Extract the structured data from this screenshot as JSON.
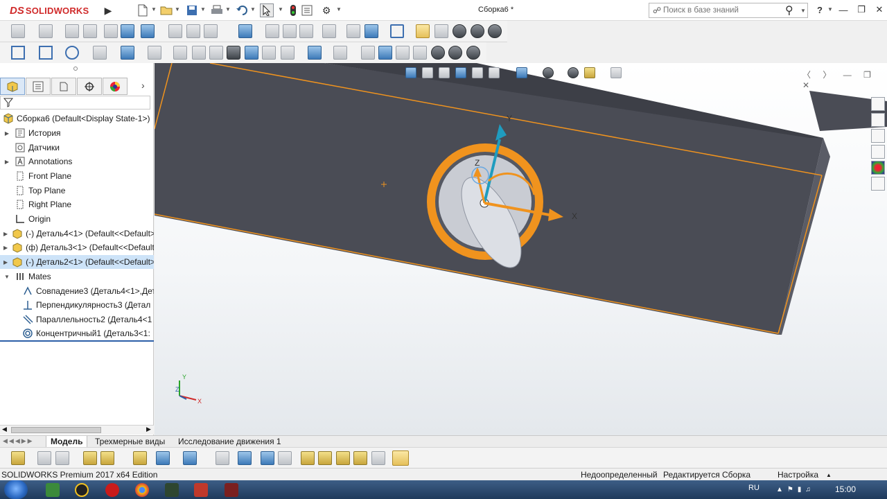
{
  "app": {
    "logo_ds": "DS",
    "logo_text": "SOLIDWORKS",
    "document_title": "Сборка6 *",
    "search_placeholder": "Поиск в базе знаний",
    "help_label": "?"
  },
  "feature_manager": {
    "root": "Сборка6  (Default<Display State-1>)",
    "items": [
      {
        "label": "История",
        "icon": "history-icon",
        "expandable": true
      },
      {
        "label": "Датчики",
        "icon": "sensor-icon",
        "expandable": false
      },
      {
        "label": "Annotations",
        "icon": "annotations-icon",
        "expandable": true
      },
      {
        "label": "Front Plane",
        "icon": "plane-icon",
        "expandable": false
      },
      {
        "label": "Top Plane",
        "icon": "plane-icon",
        "expandable": false
      },
      {
        "label": "Right Plane",
        "icon": "plane-icon",
        "expandable": false
      },
      {
        "label": "Origin",
        "icon": "origin-icon",
        "expandable": false
      },
      {
        "label": "(-) Деталь4<1> (Default<<Default>",
        "icon": "part-icon",
        "expandable": true
      },
      {
        "label": "(ф) Деталь3<1> (Default<<Default>",
        "icon": "part-icon",
        "expandable": true
      },
      {
        "label": "(-) Деталь2<1> (Default<<Default>",
        "icon": "part-icon",
        "expandable": true,
        "selected": true
      },
      {
        "label": "Mates",
        "icon": "mates-icon",
        "expandable": true,
        "expanded": true
      }
    ],
    "mates": [
      {
        "label": "Совпадение3 (Деталь4<1>,Дет",
        "icon": "coincident-icon"
      },
      {
        "label": "Перпендикулярность3 (Детал",
        "icon": "perpendicular-icon"
      },
      {
        "label": "Параллельность2 (Деталь4<1",
        "icon": "parallel-icon"
      },
      {
        "label": "Концентричный1 (Деталь3<1:",
        "icon": "concentric-icon"
      }
    ]
  },
  "viewport": {
    "axis_x": "X",
    "axis_y": "Y",
    "axis_z": "Z",
    "triad_x": "X",
    "triad_y": "Y",
    "triad_z": "Z",
    "accent_color": "#f0931e",
    "body_color": "#4a4c55"
  },
  "bottom_tabs": [
    "Модель",
    "Трехмерные виды",
    "Исследование движения 1"
  ],
  "status": {
    "edition": "SOLIDWORKS Premium 2017 x64 Edition",
    "state": "Недоопределенный",
    "editing": "Редактируется Сборка",
    "settings": "Настройка"
  },
  "taskbar": {
    "language": "RU",
    "clock": "15:00"
  }
}
